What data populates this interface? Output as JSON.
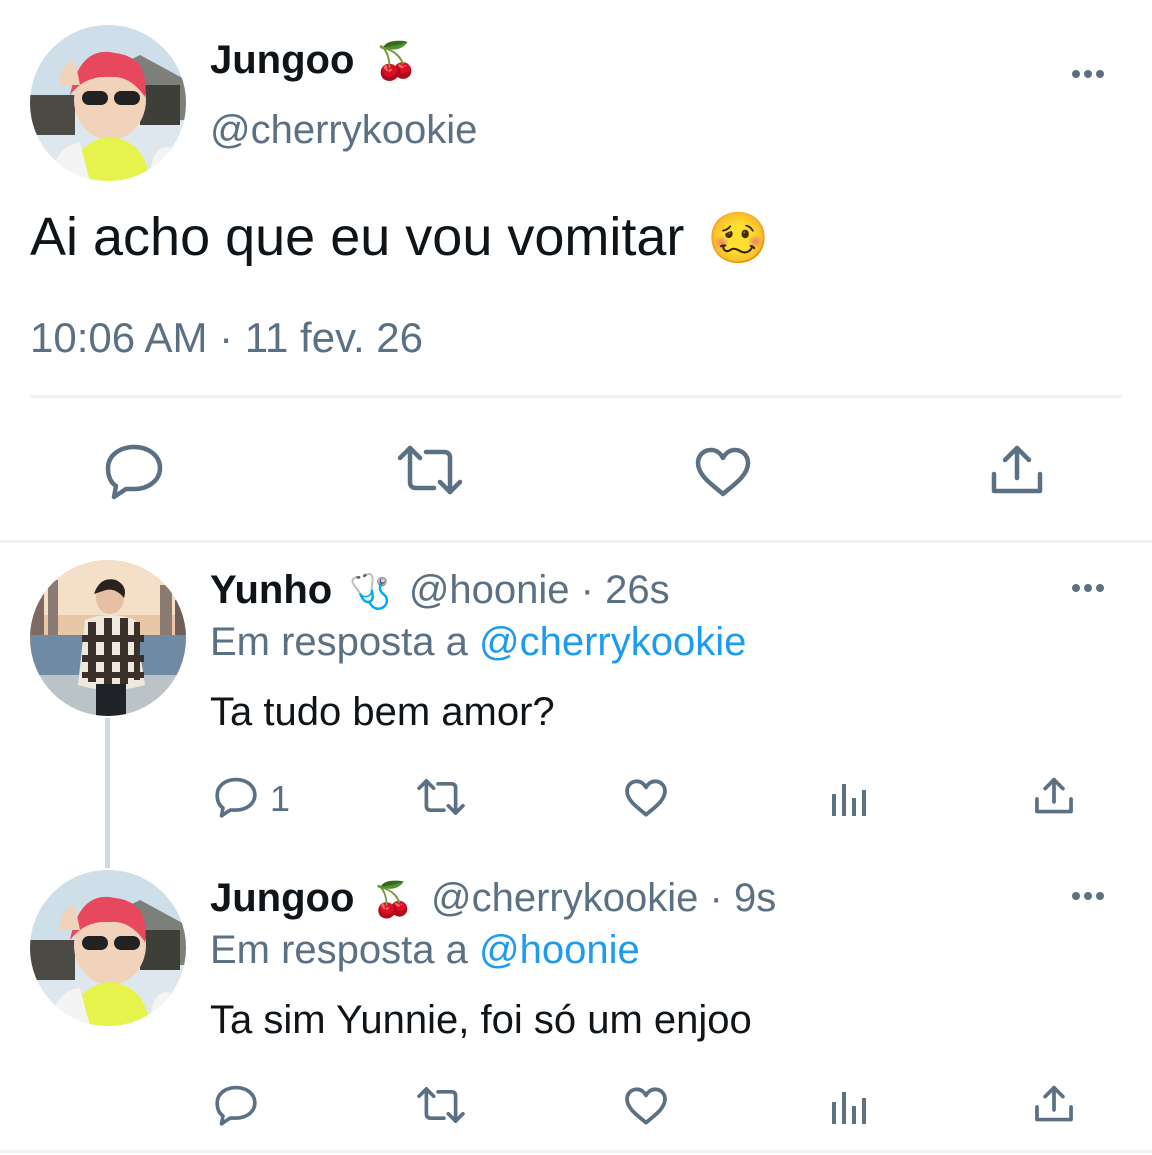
{
  "main_tweet": {
    "name": "Jungoo",
    "name_emoji": "🍒",
    "handle": "@cherrykookie",
    "text": "Ai acho que eu vou vomitar",
    "text_emoji": "🥴",
    "timestamp": "10:06 AM · 11 fev. 26",
    "actions": [
      "reply-icon",
      "retweet-icon",
      "like-icon",
      "share-icon"
    ]
  },
  "replies": [
    {
      "name": "Yunho",
      "name_emoji": "🩺",
      "handle": "@hoonie",
      "time": "· 26s",
      "reply_prefix": "Em resposta a",
      "reply_to": "@cherrykookie",
      "text": "Ta tudo bem amor?",
      "reply_count": "1"
    },
    {
      "name": "Jungoo",
      "name_emoji": "🍒",
      "handle": "@cherrykookie",
      "time": "· 9s",
      "reply_prefix": "Em resposta a",
      "reply_to": "@hoonie",
      "text": "Ta sim Yunnie, foi só um enjoo",
      "reply_count": ""
    }
  ],
  "colors": {
    "text": "#0f1419",
    "secondary": "#5b7083",
    "link": "#1d9bf0",
    "divider": "#eff3f4",
    "icon": "#5b7083"
  }
}
